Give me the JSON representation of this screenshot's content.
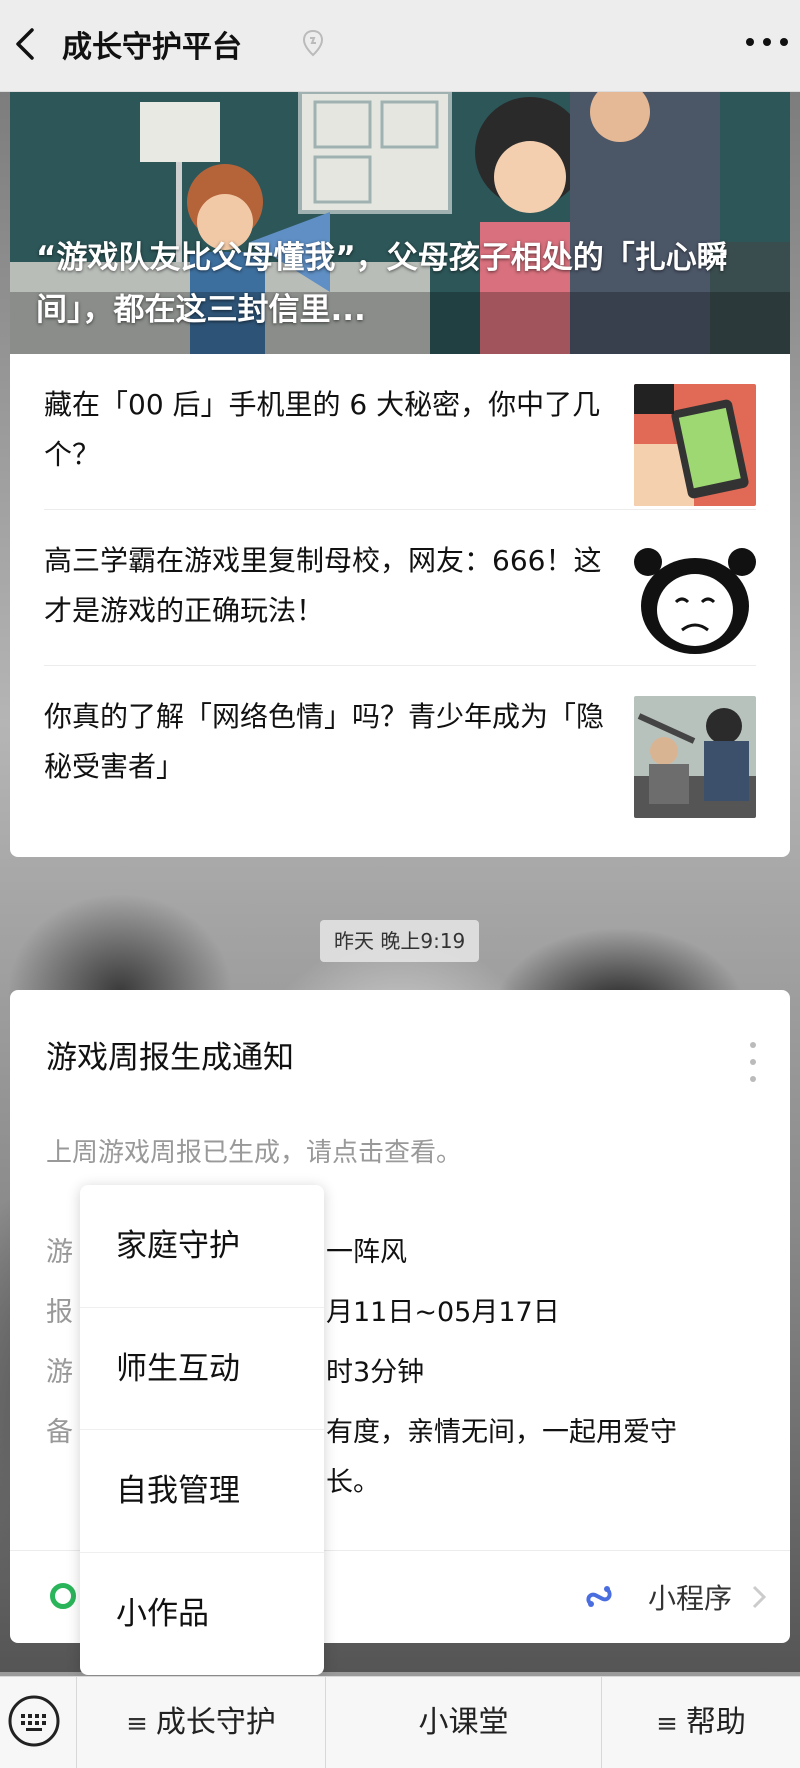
{
  "header": {
    "title": "成长守护平台"
  },
  "article_card": {
    "cover_title": "“游戏队友比父母懂我”，父母孩子相处的「扎心瞬间」，都在这三封信里...",
    "items": [
      {
        "title": "藏在「00 后」手机里的 6 大秘密，你中了几个？"
      },
      {
        "title": "高三学霸在游戏里复制母校，网友：666！这才是游戏的正确玩法！"
      },
      {
        "title": "你真的了解「网络色情」吗？青少年成为「隐秘受害者」"
      }
    ]
  },
  "timestamp": "昨天 晚上9:19",
  "notice": {
    "title": "游戏周报生成通知",
    "description": "上周游戏周报已生成，请点击查看。",
    "fields": {
      "f1_label": "游",
      "f1_value": "一阵风",
      "f2_label": "报",
      "f2_value": "月11日~05月17日",
      "f3_label": "游",
      "f3_value": "时3分钟",
      "f4_label": "备",
      "f4_value": "有度，亲情无间，一起用爱守",
      "f4_value_line2": "长。"
    },
    "footer_label": "小程序"
  },
  "popup_menu": {
    "items": [
      "家庭守护",
      "师生互动",
      "自我管理",
      "小作品"
    ]
  },
  "bottom_menu": {
    "tab1_prefix": "≡",
    "tab1_label": "成长守护",
    "tab2_label": "小课堂",
    "tab3_prefix": "≡",
    "tab3_label": "帮助"
  },
  "colors": {
    "accent_green": "#2bb55a",
    "mini_program_blue": "#4a6ee0"
  }
}
